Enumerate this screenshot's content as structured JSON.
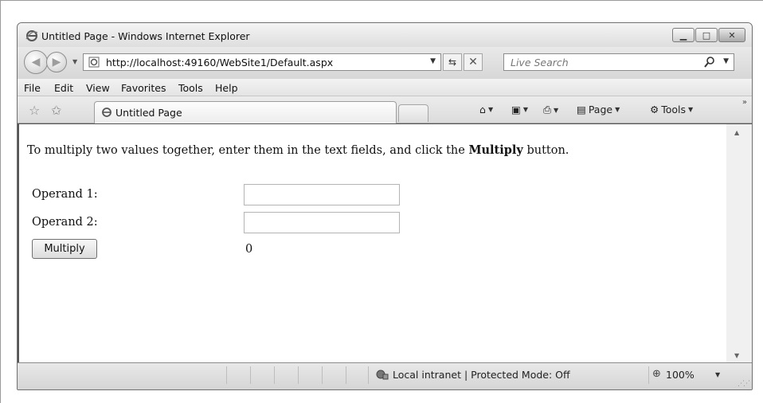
{
  "window": {
    "title": "Untitled Page - Windows Internet Explorer",
    "controls": {
      "minimize": "▁",
      "maximize": "□",
      "close": "✕"
    }
  },
  "address_bar": {
    "url": "http://localhost:49160/WebSite1/Default.aspx",
    "search_placeholder": "Live Search"
  },
  "menu": [
    "File",
    "Edit",
    "View",
    "Favorites",
    "Tools",
    "Help"
  ],
  "tab": {
    "label": "Untitled Page"
  },
  "command_bar": {
    "page_label": "Page",
    "tools_label": "Tools"
  },
  "page": {
    "intro_prefix": "To multiply two values together, enter them in the text fields, and click the ",
    "intro_bold": "Multiply",
    "intro_suffix": " button.",
    "operand1_label": "Operand 1:",
    "operand2_label": "Operand 2:",
    "operand1_value": "",
    "operand2_value": "",
    "multiply_button": "Multiply",
    "result": "0"
  },
  "status_bar": {
    "zone": "Local intranet | Protected Mode: Off",
    "zoom": "100%"
  },
  "icons": {
    "browser": "ie-logo-icon",
    "back": "back-arrow-icon",
    "forward": "forward-arrow-icon",
    "refresh": "refresh-icon",
    "stop": "stop-icon",
    "search": "search-icon",
    "favorites": "favorites-star-icon",
    "add_favorites": "add-favorites-icon",
    "home": "home-icon",
    "feeds": "feeds-icon",
    "print": "print-icon",
    "page": "page-icon",
    "tools": "gear-icon",
    "zone": "intranet-zone-icon",
    "zoom": "zoom-icon"
  }
}
